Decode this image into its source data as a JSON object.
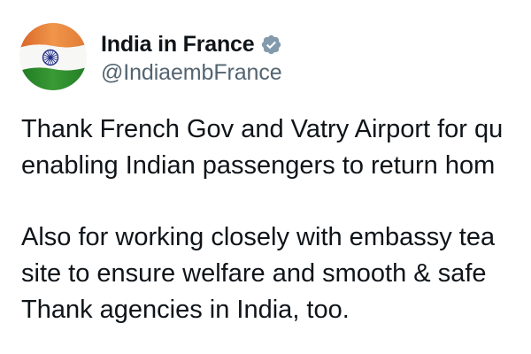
{
  "author": {
    "display_name": "India in France",
    "handle": "@IndiaembFrance",
    "verified": true,
    "avatar": "indian-flag-avatar",
    "verified_badge": "verified-badge-icon"
  },
  "tweet": {
    "paragraph1": [
      "Thank French Gov and Vatry Airport for qu",
      "enabling Indian passengers to return hom"
    ],
    "paragraph2": [
      "Also for working closely with embassy tea",
      "site to ensure welfare and smooth & safe",
      "Thank agencies in India, too."
    ]
  },
  "colors": {
    "text_primary": "#0f1419",
    "text_secondary": "#536471",
    "verified_badge": "#829aab",
    "flag_saffron": "#e8843c",
    "flag_white": "#ffffff",
    "flag_green": "#2c8a2c",
    "flag_chakra": "#1a2a8a"
  }
}
